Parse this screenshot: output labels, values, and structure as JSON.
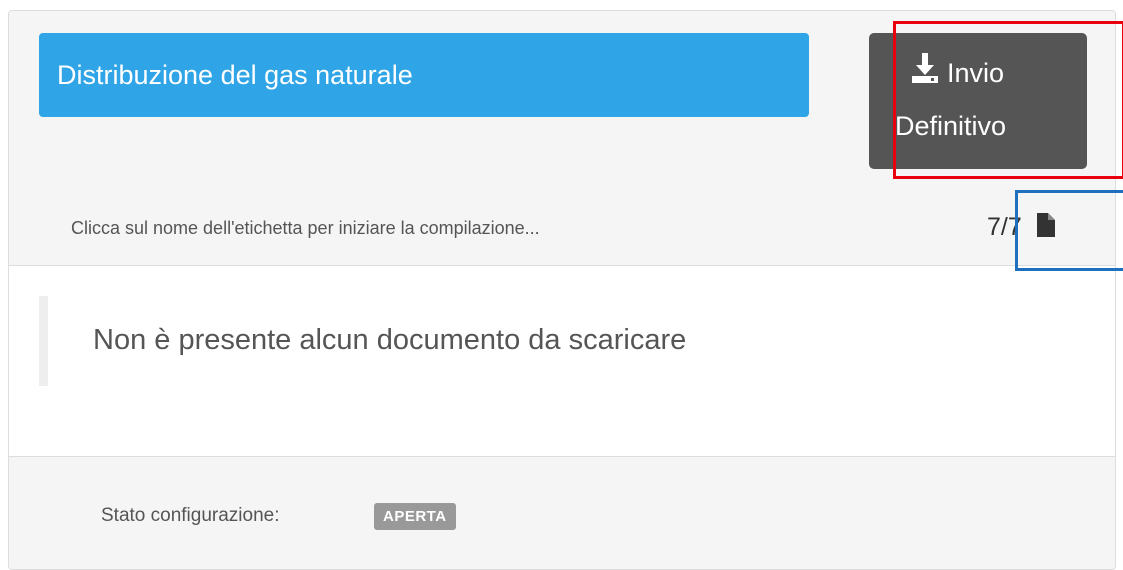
{
  "header": {
    "title": "Distribuzione del gas naturale",
    "submit_button": {
      "icon": "download-icon",
      "line1": "Invio",
      "line2": "Definitivo"
    },
    "hint": "Clicca sul nome dell'etichetta per iniziare la compilazione...",
    "counter": "7/7",
    "counter_icon": "file-icon"
  },
  "body": {
    "message": "Non è presente alcun documento da scaricare"
  },
  "footer": {
    "status_label": "Stato configurazione:",
    "status_badge": "APERTA"
  },
  "colors": {
    "title_bg": "#2fa4e7",
    "button_bg": "#555555",
    "badge_bg": "#999999",
    "annotation_red": "#e8000d",
    "annotation_blue": "#1f6fbf"
  }
}
